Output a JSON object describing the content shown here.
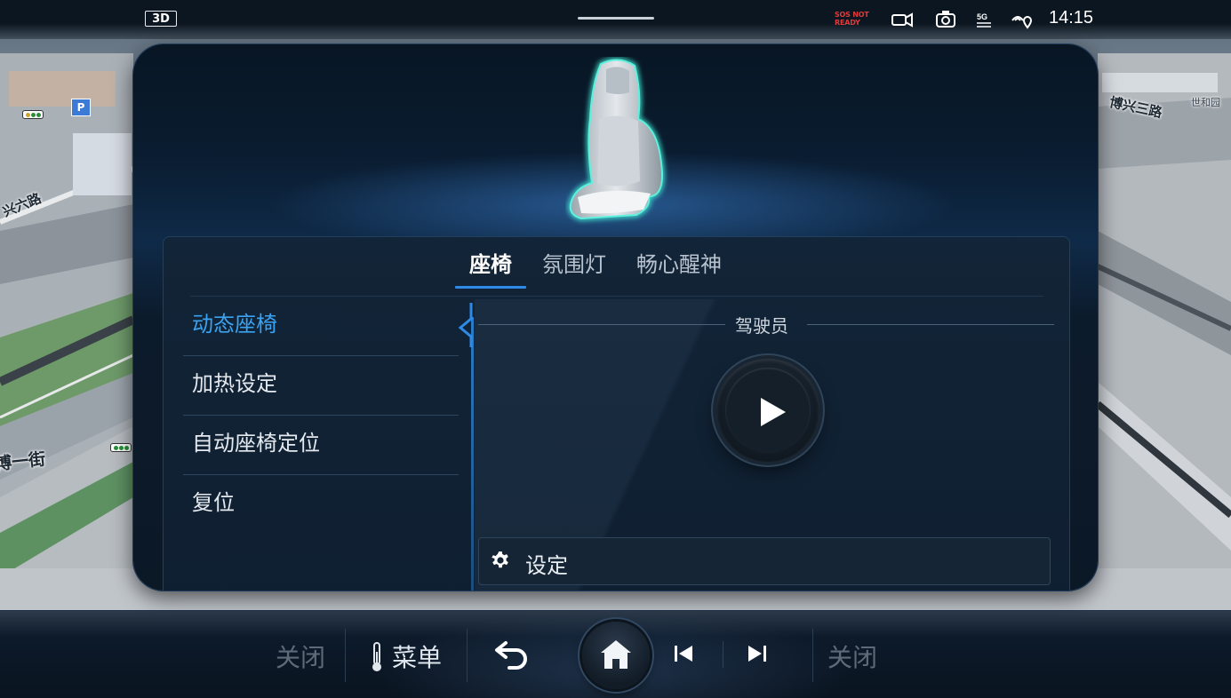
{
  "status_bar": {
    "view_mode": "3D",
    "sos_status": "SOS NOT READY",
    "network": "5G",
    "time": "14:15",
    "icons": [
      "camera-icon",
      "dashcam-icon",
      "5g-signal-icon",
      "location-signal-icon"
    ]
  },
  "map": {
    "labels": [
      "博兴三路",
      "世和园",
      "兴六路",
      "博一街"
    ],
    "parking_badge": "P"
  },
  "seat_panel": {
    "tabs": [
      {
        "label": "座椅",
        "active": true
      },
      {
        "label": "氛围灯",
        "active": false
      },
      {
        "label": "畅心醒神",
        "active": false
      }
    ],
    "menu": [
      {
        "label": "动态座椅",
        "active": true
      },
      {
        "label": "加热设定",
        "active": false
      },
      {
        "label": "自动座椅定位",
        "active": false
      },
      {
        "label": "复位",
        "active": false
      }
    ],
    "section_title": "驾驶员",
    "settings_label": "设定"
  },
  "dock": {
    "left_close": "关闭",
    "menu_label": "菜单",
    "right_close": "关闭",
    "icons": [
      "thermometer-icon",
      "back-icon",
      "home-icon",
      "previous-track-icon",
      "next-track-icon"
    ]
  },
  "colors": {
    "accent": "#2e8ae6",
    "active_menu": "#3aa2f0",
    "sos": "#e03a3a",
    "panel": "#0f1f31"
  }
}
